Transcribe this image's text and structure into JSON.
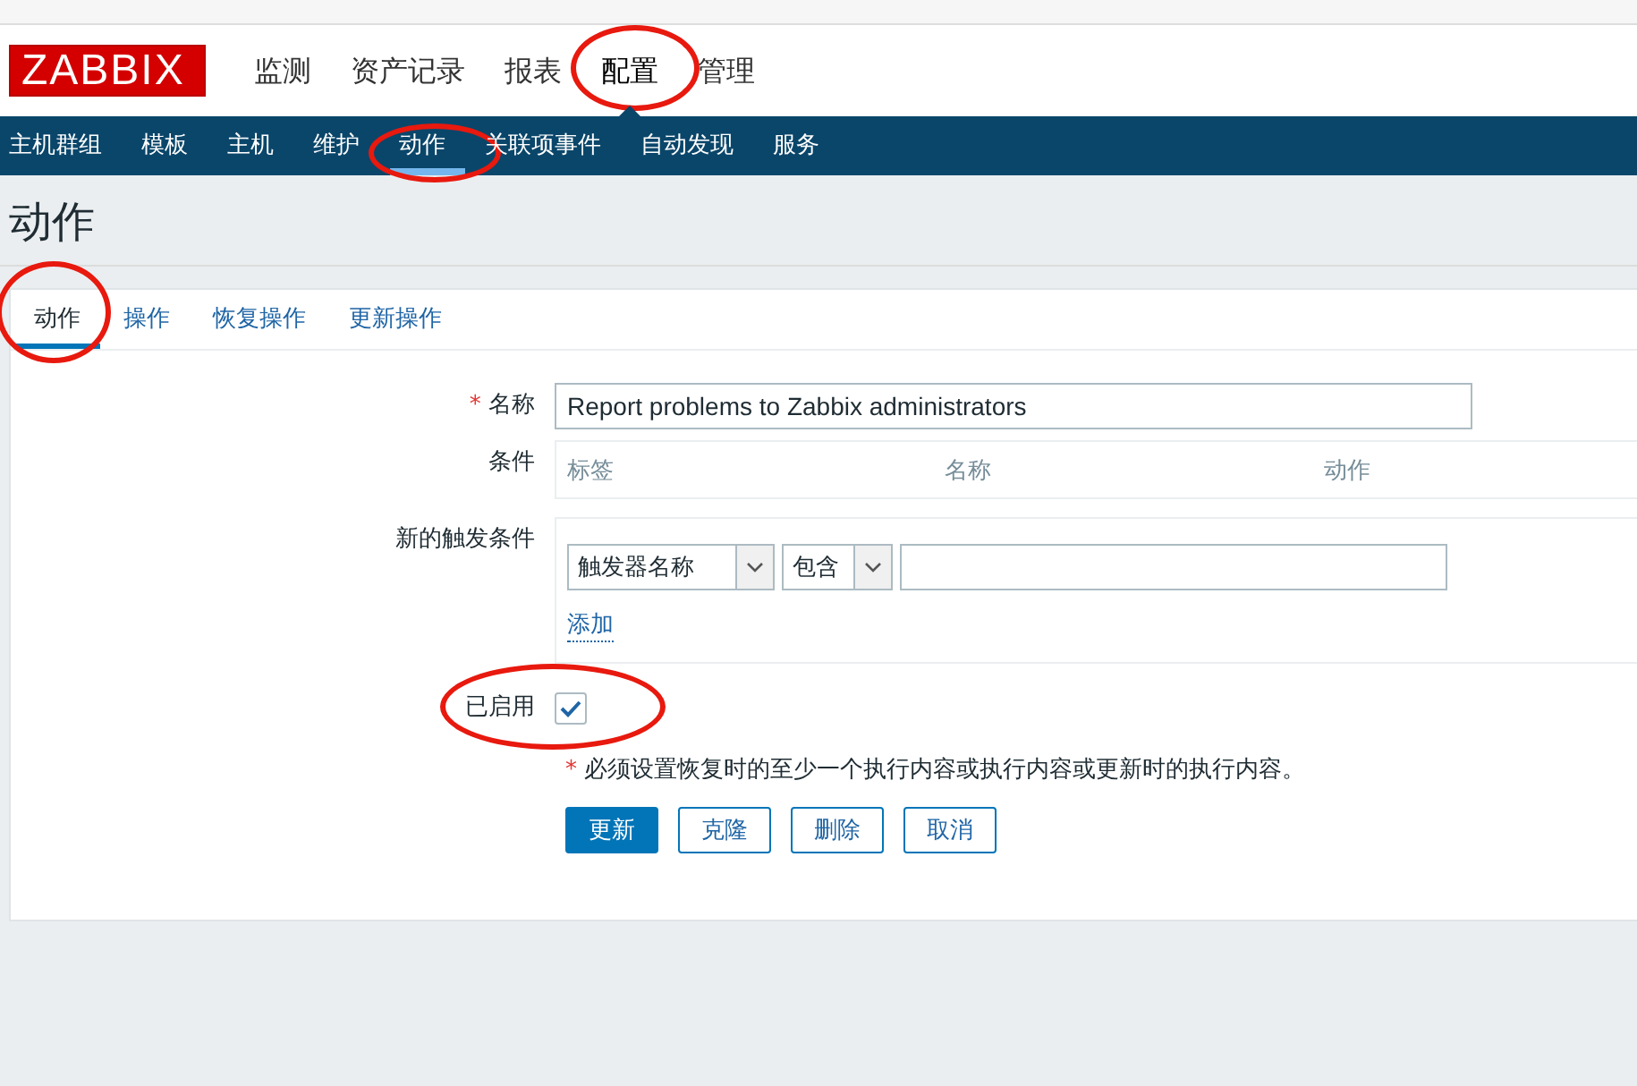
{
  "logo": "ZABBIX",
  "main_menu": [
    {
      "label": "监测",
      "selected": false,
      "circled": false
    },
    {
      "label": "资产记录",
      "selected": false,
      "circled": false
    },
    {
      "label": "报表",
      "selected": false,
      "circled": false
    },
    {
      "label": "配置",
      "selected": true,
      "circled": true
    },
    {
      "label": "管理",
      "selected": false,
      "circled": false
    }
  ],
  "sub_menu": [
    {
      "label": "主机群组",
      "selected": false,
      "circled": false
    },
    {
      "label": "模板",
      "selected": false,
      "circled": false
    },
    {
      "label": "主机",
      "selected": false,
      "circled": false
    },
    {
      "label": "维护",
      "selected": false,
      "circled": false
    },
    {
      "label": "动作",
      "selected": true,
      "circled": true
    },
    {
      "label": "关联项事件",
      "selected": false,
      "circled": false
    },
    {
      "label": "自动发现",
      "selected": false,
      "circled": false
    },
    {
      "label": "服务",
      "selected": false,
      "circled": false
    }
  ],
  "page_title": "动作",
  "tabs": [
    {
      "label": "动作",
      "selected": true,
      "circled": true
    },
    {
      "label": "操作",
      "selected": false,
      "circled": false
    },
    {
      "label": "恢复操作",
      "selected": false,
      "circled": false
    },
    {
      "label": "更新操作",
      "selected": false,
      "circled": false
    }
  ],
  "form": {
    "required_mark": "*",
    "name_label": "名称",
    "name_value": "Report problems to Zabbix administrators",
    "conditions_label": "条件",
    "conditions_columns": [
      "标签",
      "名称",
      "动作"
    ],
    "new_condition_label": "新的触发条件",
    "condition_type": "触发器名称",
    "condition_operator": "包含",
    "add_link": "添加",
    "enabled_label": "已启用",
    "enabled": true,
    "enabled_circled": true,
    "note_mark": "*",
    "note": "必须设置恢复时的至少一个执行内容或执行内容或更新时的执行内容。"
  },
  "buttons": [
    {
      "label": "更新",
      "kind": "primary"
    },
    {
      "label": "克隆",
      "kind": "secondary"
    },
    {
      "label": "删除",
      "kind": "secondary"
    },
    {
      "label": "取消",
      "kind": "secondary"
    }
  ]
}
